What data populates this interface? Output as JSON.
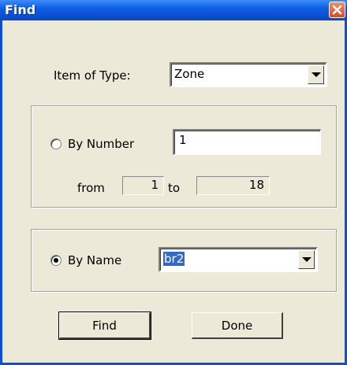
{
  "window": {
    "title": "Find"
  },
  "type_row": {
    "label": "Item of Type:",
    "selected": "Zone"
  },
  "by_number": {
    "label": "By Number",
    "value": "1",
    "selected": false,
    "from_label": "from",
    "from_value": "1",
    "to_label": "to",
    "to_value": "18"
  },
  "by_name": {
    "label": "By Name",
    "value": "br2",
    "selected": true
  },
  "buttons": {
    "find": "Find",
    "done": "Done"
  },
  "icons": {
    "close": "close-icon",
    "dropdown": "chevron-down-icon"
  },
  "colors": {
    "titlebar": "#0A52D8",
    "face": "#ECE9D8",
    "selection": "#316AC5",
    "close": "#DB4A22"
  }
}
